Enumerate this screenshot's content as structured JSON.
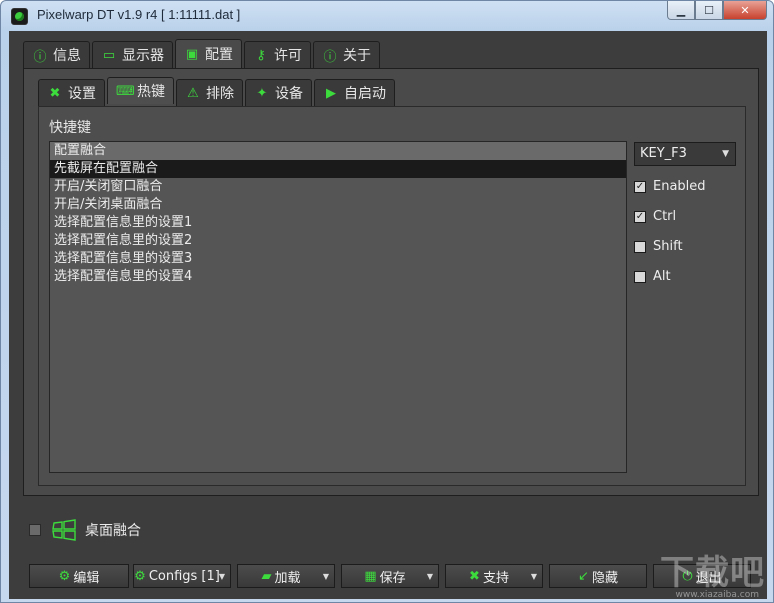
{
  "window": {
    "title": "Pixelwarp DT v1.9 r4 [ 1:11111.dat ]",
    "min_glyph": "▁",
    "max_glyph": "☐",
    "close_glyph": "✕"
  },
  "top_tabs": [
    {
      "label": "信息",
      "icon": "info-icon",
      "glyph": "ⓘ"
    },
    {
      "label": "显示器",
      "icon": "display-icon",
      "glyph": "▭"
    },
    {
      "label": "配置",
      "icon": "config-icon",
      "glyph": "▣"
    },
    {
      "label": "许可",
      "icon": "key-icon",
      "glyph": "⚷"
    },
    {
      "label": "关于",
      "icon": "about-icon",
      "glyph": "ⓘ"
    }
  ],
  "inner_tabs": [
    {
      "label": "设置",
      "icon": "tools-icon",
      "glyph": "✖"
    },
    {
      "label": "热键",
      "icon": "keyboard-icon",
      "glyph": "⌨"
    },
    {
      "label": "排除",
      "icon": "warning-icon",
      "glyph": "⚠"
    },
    {
      "label": "设备",
      "icon": "wand-icon",
      "glyph": "✦"
    },
    {
      "label": "自启动",
      "icon": "play-icon",
      "glyph": "▶"
    }
  ],
  "hotkeys": {
    "label": "快捷键",
    "items": [
      "配置融合",
      "先截屏在配置融合",
      "开启/关闭窗口融合",
      "开启/关闭桌面融合",
      "选择配置信息里的设置1",
      "选择配置信息里的设置2",
      "选择配置信息里的设置3",
      "选择配置信息里的设置4"
    ],
    "key_select": "KEY_F3",
    "checkboxes": [
      {
        "label": "Enabled",
        "checked": true,
        "mark": "✓"
      },
      {
        "label": "Ctrl",
        "checked": true,
        "mark": "✓"
      },
      {
        "label": "Shift",
        "checked": false,
        "mark": ""
      },
      {
        "label": "Alt",
        "checked": false,
        "mark": ""
      }
    ]
  },
  "desktop_blend": {
    "label": "桌面融合",
    "checked": false
  },
  "buttons": [
    {
      "label": "编辑",
      "icon": "edit-icon",
      "glyph": "⚙",
      "dropdown": false
    },
    {
      "label": "Configs [1]",
      "icon": "gear-icon",
      "glyph": "⚙",
      "dropdown": true
    },
    {
      "label": "加载",
      "icon": "folder-icon",
      "glyph": "▰",
      "dropdown": true
    },
    {
      "label": "保存",
      "icon": "save-icon",
      "glyph": "▦",
      "dropdown": true
    },
    {
      "label": "支持",
      "icon": "tools-icon",
      "glyph": "✖",
      "dropdown": true
    },
    {
      "label": "隐藏",
      "icon": "minimize-icon",
      "glyph": "↙",
      "dropdown": false
    },
    {
      "label": "退出",
      "icon": "power-icon",
      "glyph": "⏻",
      "dropdown": false
    }
  ],
  "dropdown_glyph": "▼",
  "colors": {
    "accent": "#3ddc3d",
    "background": "#3d3d3d",
    "selection": "#1a1a1a"
  },
  "watermark": {
    "text": "下载吧",
    "url": "www.xiazaiba.com"
  }
}
